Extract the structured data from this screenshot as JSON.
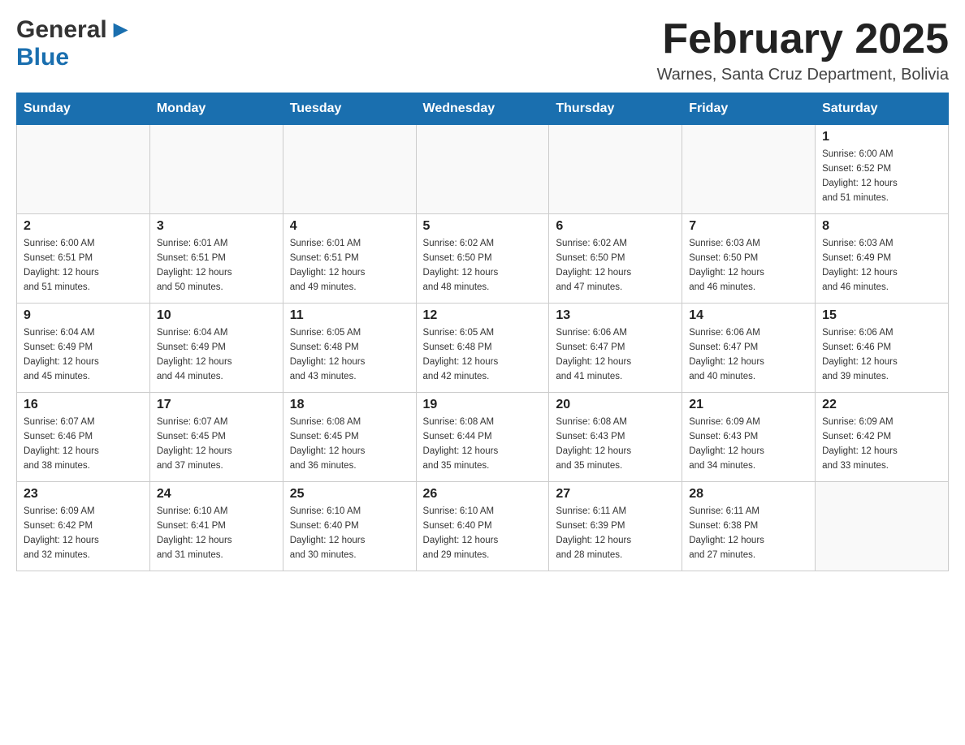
{
  "header": {
    "logo_general": "General",
    "logo_blue": "Blue",
    "month_title": "February 2025",
    "location": "Warnes, Santa Cruz Department, Bolivia"
  },
  "weekdays": [
    "Sunday",
    "Monday",
    "Tuesday",
    "Wednesday",
    "Thursday",
    "Friday",
    "Saturday"
  ],
  "weeks": [
    [
      {
        "day": "",
        "info": ""
      },
      {
        "day": "",
        "info": ""
      },
      {
        "day": "",
        "info": ""
      },
      {
        "day": "",
        "info": ""
      },
      {
        "day": "",
        "info": ""
      },
      {
        "day": "",
        "info": ""
      },
      {
        "day": "1",
        "info": "Sunrise: 6:00 AM\nSunset: 6:52 PM\nDaylight: 12 hours\nand 51 minutes."
      }
    ],
    [
      {
        "day": "2",
        "info": "Sunrise: 6:00 AM\nSunset: 6:51 PM\nDaylight: 12 hours\nand 51 minutes."
      },
      {
        "day": "3",
        "info": "Sunrise: 6:01 AM\nSunset: 6:51 PM\nDaylight: 12 hours\nand 50 minutes."
      },
      {
        "day": "4",
        "info": "Sunrise: 6:01 AM\nSunset: 6:51 PM\nDaylight: 12 hours\nand 49 minutes."
      },
      {
        "day": "5",
        "info": "Sunrise: 6:02 AM\nSunset: 6:50 PM\nDaylight: 12 hours\nand 48 minutes."
      },
      {
        "day": "6",
        "info": "Sunrise: 6:02 AM\nSunset: 6:50 PM\nDaylight: 12 hours\nand 47 minutes."
      },
      {
        "day": "7",
        "info": "Sunrise: 6:03 AM\nSunset: 6:50 PM\nDaylight: 12 hours\nand 46 minutes."
      },
      {
        "day": "8",
        "info": "Sunrise: 6:03 AM\nSunset: 6:49 PM\nDaylight: 12 hours\nand 46 minutes."
      }
    ],
    [
      {
        "day": "9",
        "info": "Sunrise: 6:04 AM\nSunset: 6:49 PM\nDaylight: 12 hours\nand 45 minutes."
      },
      {
        "day": "10",
        "info": "Sunrise: 6:04 AM\nSunset: 6:49 PM\nDaylight: 12 hours\nand 44 minutes."
      },
      {
        "day": "11",
        "info": "Sunrise: 6:05 AM\nSunset: 6:48 PM\nDaylight: 12 hours\nand 43 minutes."
      },
      {
        "day": "12",
        "info": "Sunrise: 6:05 AM\nSunset: 6:48 PM\nDaylight: 12 hours\nand 42 minutes."
      },
      {
        "day": "13",
        "info": "Sunrise: 6:06 AM\nSunset: 6:47 PM\nDaylight: 12 hours\nand 41 minutes."
      },
      {
        "day": "14",
        "info": "Sunrise: 6:06 AM\nSunset: 6:47 PM\nDaylight: 12 hours\nand 40 minutes."
      },
      {
        "day": "15",
        "info": "Sunrise: 6:06 AM\nSunset: 6:46 PM\nDaylight: 12 hours\nand 39 minutes."
      }
    ],
    [
      {
        "day": "16",
        "info": "Sunrise: 6:07 AM\nSunset: 6:46 PM\nDaylight: 12 hours\nand 38 minutes."
      },
      {
        "day": "17",
        "info": "Sunrise: 6:07 AM\nSunset: 6:45 PM\nDaylight: 12 hours\nand 37 minutes."
      },
      {
        "day": "18",
        "info": "Sunrise: 6:08 AM\nSunset: 6:45 PM\nDaylight: 12 hours\nand 36 minutes."
      },
      {
        "day": "19",
        "info": "Sunrise: 6:08 AM\nSunset: 6:44 PM\nDaylight: 12 hours\nand 35 minutes."
      },
      {
        "day": "20",
        "info": "Sunrise: 6:08 AM\nSunset: 6:43 PM\nDaylight: 12 hours\nand 35 minutes."
      },
      {
        "day": "21",
        "info": "Sunrise: 6:09 AM\nSunset: 6:43 PM\nDaylight: 12 hours\nand 34 minutes."
      },
      {
        "day": "22",
        "info": "Sunrise: 6:09 AM\nSunset: 6:42 PM\nDaylight: 12 hours\nand 33 minutes."
      }
    ],
    [
      {
        "day": "23",
        "info": "Sunrise: 6:09 AM\nSunset: 6:42 PM\nDaylight: 12 hours\nand 32 minutes."
      },
      {
        "day": "24",
        "info": "Sunrise: 6:10 AM\nSunset: 6:41 PM\nDaylight: 12 hours\nand 31 minutes."
      },
      {
        "day": "25",
        "info": "Sunrise: 6:10 AM\nSunset: 6:40 PM\nDaylight: 12 hours\nand 30 minutes."
      },
      {
        "day": "26",
        "info": "Sunrise: 6:10 AM\nSunset: 6:40 PM\nDaylight: 12 hours\nand 29 minutes."
      },
      {
        "day": "27",
        "info": "Sunrise: 6:11 AM\nSunset: 6:39 PM\nDaylight: 12 hours\nand 28 minutes."
      },
      {
        "day": "28",
        "info": "Sunrise: 6:11 AM\nSunset: 6:38 PM\nDaylight: 12 hours\nand 27 minutes."
      },
      {
        "day": "",
        "info": ""
      }
    ]
  ]
}
